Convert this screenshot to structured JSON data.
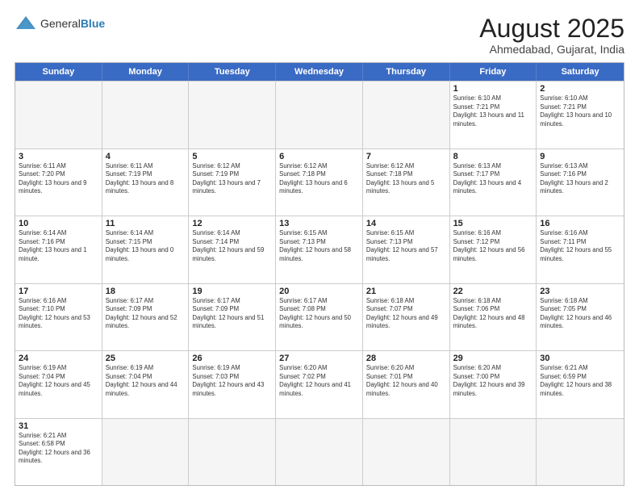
{
  "logo": {
    "text_general": "General",
    "text_blue": "Blue"
  },
  "title": "August 2025",
  "subtitle": "Ahmedabad, Gujarat, India",
  "weekdays": [
    "Sunday",
    "Monday",
    "Tuesday",
    "Wednesday",
    "Thursday",
    "Friday",
    "Saturday"
  ],
  "weeks": [
    [
      {
        "date": "",
        "info": ""
      },
      {
        "date": "",
        "info": ""
      },
      {
        "date": "",
        "info": ""
      },
      {
        "date": "",
        "info": ""
      },
      {
        "date": "",
        "info": ""
      },
      {
        "date": "1",
        "info": "Sunrise: 6:10 AM\nSunset: 7:21 PM\nDaylight: 13 hours and 11 minutes."
      },
      {
        "date": "2",
        "info": "Sunrise: 6:10 AM\nSunset: 7:21 PM\nDaylight: 13 hours and 10 minutes."
      }
    ],
    [
      {
        "date": "3",
        "info": "Sunrise: 6:11 AM\nSunset: 7:20 PM\nDaylight: 13 hours and 9 minutes."
      },
      {
        "date": "4",
        "info": "Sunrise: 6:11 AM\nSunset: 7:19 PM\nDaylight: 13 hours and 8 minutes."
      },
      {
        "date": "5",
        "info": "Sunrise: 6:12 AM\nSunset: 7:19 PM\nDaylight: 13 hours and 7 minutes."
      },
      {
        "date": "6",
        "info": "Sunrise: 6:12 AM\nSunset: 7:18 PM\nDaylight: 13 hours and 6 minutes."
      },
      {
        "date": "7",
        "info": "Sunrise: 6:12 AM\nSunset: 7:18 PM\nDaylight: 13 hours and 5 minutes."
      },
      {
        "date": "8",
        "info": "Sunrise: 6:13 AM\nSunset: 7:17 PM\nDaylight: 13 hours and 4 minutes."
      },
      {
        "date": "9",
        "info": "Sunrise: 6:13 AM\nSunset: 7:16 PM\nDaylight: 13 hours and 2 minutes."
      }
    ],
    [
      {
        "date": "10",
        "info": "Sunrise: 6:14 AM\nSunset: 7:16 PM\nDaylight: 13 hours and 1 minute."
      },
      {
        "date": "11",
        "info": "Sunrise: 6:14 AM\nSunset: 7:15 PM\nDaylight: 13 hours and 0 minutes."
      },
      {
        "date": "12",
        "info": "Sunrise: 6:14 AM\nSunset: 7:14 PM\nDaylight: 12 hours and 59 minutes."
      },
      {
        "date": "13",
        "info": "Sunrise: 6:15 AM\nSunset: 7:13 PM\nDaylight: 12 hours and 58 minutes."
      },
      {
        "date": "14",
        "info": "Sunrise: 6:15 AM\nSunset: 7:13 PM\nDaylight: 12 hours and 57 minutes."
      },
      {
        "date": "15",
        "info": "Sunrise: 6:16 AM\nSunset: 7:12 PM\nDaylight: 12 hours and 56 minutes."
      },
      {
        "date": "16",
        "info": "Sunrise: 6:16 AM\nSunset: 7:11 PM\nDaylight: 12 hours and 55 minutes."
      }
    ],
    [
      {
        "date": "17",
        "info": "Sunrise: 6:16 AM\nSunset: 7:10 PM\nDaylight: 12 hours and 53 minutes."
      },
      {
        "date": "18",
        "info": "Sunrise: 6:17 AM\nSunset: 7:09 PM\nDaylight: 12 hours and 52 minutes."
      },
      {
        "date": "19",
        "info": "Sunrise: 6:17 AM\nSunset: 7:09 PM\nDaylight: 12 hours and 51 minutes."
      },
      {
        "date": "20",
        "info": "Sunrise: 6:17 AM\nSunset: 7:08 PM\nDaylight: 12 hours and 50 minutes."
      },
      {
        "date": "21",
        "info": "Sunrise: 6:18 AM\nSunset: 7:07 PM\nDaylight: 12 hours and 49 minutes."
      },
      {
        "date": "22",
        "info": "Sunrise: 6:18 AM\nSunset: 7:06 PM\nDaylight: 12 hours and 48 minutes."
      },
      {
        "date": "23",
        "info": "Sunrise: 6:18 AM\nSunset: 7:05 PM\nDaylight: 12 hours and 46 minutes."
      }
    ],
    [
      {
        "date": "24",
        "info": "Sunrise: 6:19 AM\nSunset: 7:04 PM\nDaylight: 12 hours and 45 minutes."
      },
      {
        "date": "25",
        "info": "Sunrise: 6:19 AM\nSunset: 7:04 PM\nDaylight: 12 hours and 44 minutes."
      },
      {
        "date": "26",
        "info": "Sunrise: 6:19 AM\nSunset: 7:03 PM\nDaylight: 12 hours and 43 minutes."
      },
      {
        "date": "27",
        "info": "Sunrise: 6:20 AM\nSunset: 7:02 PM\nDaylight: 12 hours and 41 minutes."
      },
      {
        "date": "28",
        "info": "Sunrise: 6:20 AM\nSunset: 7:01 PM\nDaylight: 12 hours and 40 minutes."
      },
      {
        "date": "29",
        "info": "Sunrise: 6:20 AM\nSunset: 7:00 PM\nDaylight: 12 hours and 39 minutes."
      },
      {
        "date": "30",
        "info": "Sunrise: 6:21 AM\nSunset: 6:59 PM\nDaylight: 12 hours and 38 minutes."
      }
    ],
    [
      {
        "date": "31",
        "info": "Sunrise: 6:21 AM\nSunset: 6:58 PM\nDaylight: 12 hours and 36 minutes."
      },
      {
        "date": "",
        "info": ""
      },
      {
        "date": "",
        "info": ""
      },
      {
        "date": "",
        "info": ""
      },
      {
        "date": "",
        "info": ""
      },
      {
        "date": "",
        "info": ""
      },
      {
        "date": "",
        "info": ""
      }
    ]
  ]
}
